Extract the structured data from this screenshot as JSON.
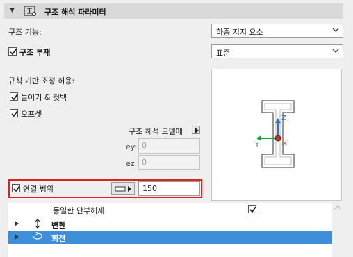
{
  "panel": {
    "title": "구조 해석 파라미터",
    "title_icon": "structural-analysis-icon"
  },
  "structural_function": {
    "label": "구조 기능:",
    "value": "하중 지지 요소"
  },
  "structural_member": {
    "label": "구조 부재",
    "checked": true,
    "value": "표준"
  },
  "rule_based": {
    "label": "규칙 기반 조정 허용:",
    "extend_trim_label": "늘이기 & 컷백",
    "extend_trim_checked": true,
    "offset_label": "오프셋",
    "offset_checked": true
  },
  "analytical_model": {
    "label": "구조 해석 모델에",
    "ey_label": "ey:",
    "ey_value": "0",
    "ez_label": "ez:",
    "ez_value": "0"
  },
  "preview": {
    "axis_z": "Z",
    "axis_y": "Y",
    "axis_x": "×"
  },
  "connection_range": {
    "label": "연결 범위",
    "checked": true,
    "value": "150"
  },
  "list": {
    "items": [
      {
        "label": "동일한 단부해제",
        "checked": true,
        "bold": false,
        "expandable": false,
        "icon": ""
      },
      {
        "label": "변환",
        "bold": true,
        "expandable": true,
        "icon": "translate-arrow-icon"
      },
      {
        "label": "회전",
        "bold": true,
        "expandable": true,
        "icon": "rotate-icon",
        "selected": true
      }
    ]
  },
  "colors": {
    "accent_selection": "#3f8fd8",
    "highlight_border": "#e0201b"
  }
}
